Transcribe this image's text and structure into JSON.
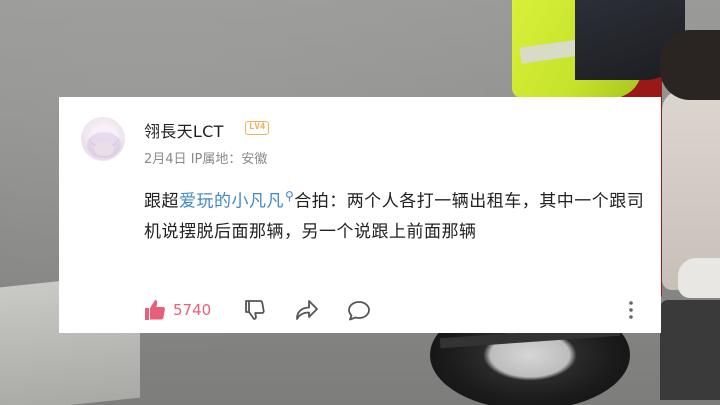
{
  "comment": {
    "username": "翎長天LCT",
    "level_badge": "LV4",
    "date": "2月4日",
    "ip_location": "IP属地：安徽",
    "text_prefix": "跟超",
    "mention": "爱玩的小凡凡",
    "text_rest": "合拍：两个人各打一辆出租车，其中一个跟司机说摆脱后面那辆，另一个说跟上前面那辆",
    "like_count": "5740"
  },
  "icons": {
    "mention": "search-icon",
    "like": "thumb-up-icon",
    "dislike": "thumb-down-icon",
    "share": "share-arrow-icon",
    "reply": "comment-bubble-icon",
    "more": "more-vertical-icon"
  },
  "colors": {
    "mention": "#3f88c7",
    "like_active": "#e85f7a",
    "level_badge": "#f0b05a"
  }
}
